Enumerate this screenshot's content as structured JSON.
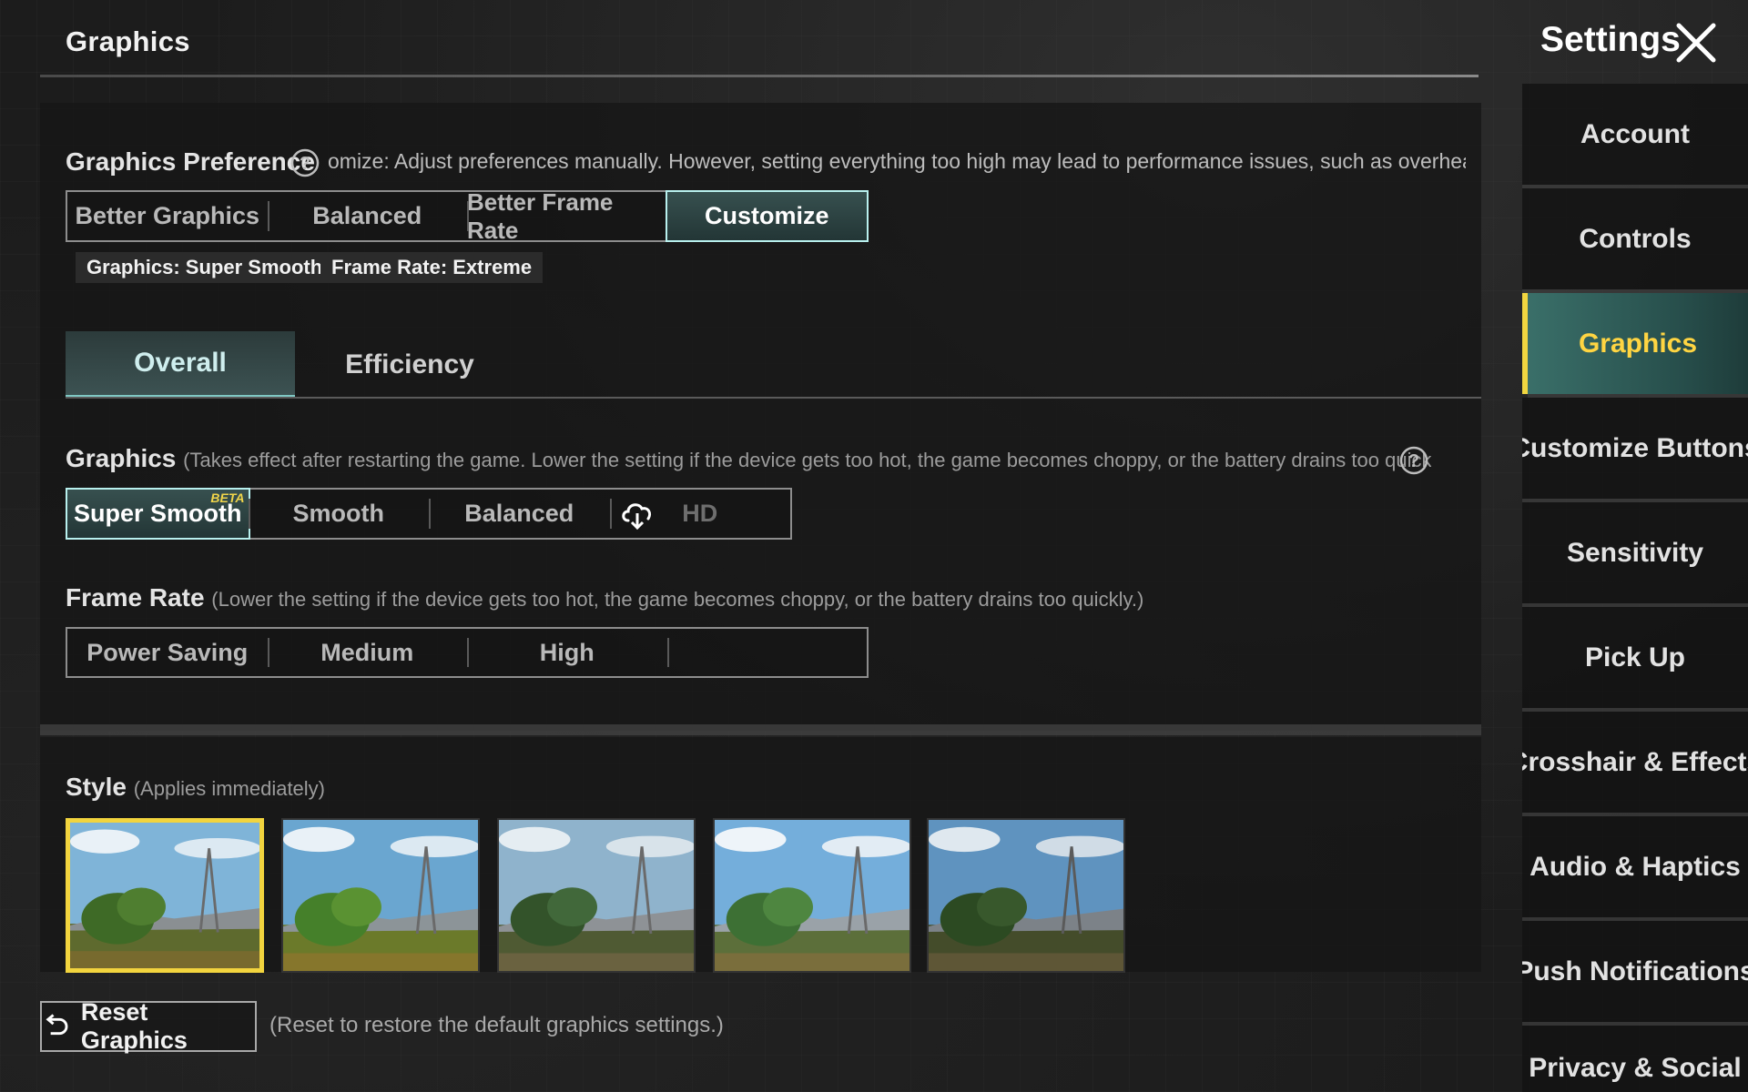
{
  "header": {
    "page_title": "Graphics",
    "settings_title": "Settings"
  },
  "graphics_preference": {
    "label": "Graphics Preference",
    "description": "omize: Adjust preferences manually. However, setting everything too high may lead to performance issues, such as overheating, b",
    "options": [
      "Better Graphics",
      "Balanced",
      "Better Frame Rate",
      "Customize"
    ],
    "selected": "Customize",
    "tags": [
      "Graphics: Super Smooth",
      "Frame Rate: Extreme"
    ]
  },
  "tabs": {
    "items": [
      "Overall",
      "Efficiency"
    ],
    "active": "Overall"
  },
  "graphics": {
    "label": "Graphics",
    "hint": "(Takes effect after restarting the game. Lower the setting if the device gets too hot, the game becomes choppy, or the battery drains too quickly.)",
    "options": [
      "Super Smooth",
      "Smooth",
      "Balanced",
      "HD"
    ],
    "selected": "Super Smooth",
    "beta_badge": "BETA"
  },
  "frame_rate": {
    "label": "Frame Rate",
    "hint": "(Lower the setting if the device gets too hot, the game becomes choppy, or the battery drains too quickly.)",
    "options": [
      "Power Saving",
      "Medium",
      "High",
      ""
    ]
  },
  "style": {
    "label": "Style",
    "hint": "(Applies immediately)",
    "selected_index": 0,
    "count": 5
  },
  "reset": {
    "button_label": "Reset Graphics",
    "hint": "(Reset to restore the default graphics settings.)"
  },
  "sidebar": {
    "items": [
      {
        "label": "Account"
      },
      {
        "label": "Controls"
      },
      {
        "label": "Graphics"
      },
      {
        "label": "Customize Buttons"
      },
      {
        "label": "Sensitivity"
      },
      {
        "label": "Pick Up"
      },
      {
        "label": "Crosshair & Effects"
      },
      {
        "label": "Audio & Haptics"
      },
      {
        "label": "Push Notifications"
      },
      {
        "label": "Privacy & Social"
      }
    ],
    "active_index": 2
  },
  "colors": {
    "accent_teal": "#b8f0ee",
    "accent_yellow": "#f2d43e"
  },
  "icons": {
    "help": "help-icon",
    "close": "close-icon",
    "download": "cloud-download-icon",
    "reset": "reset-icon"
  }
}
